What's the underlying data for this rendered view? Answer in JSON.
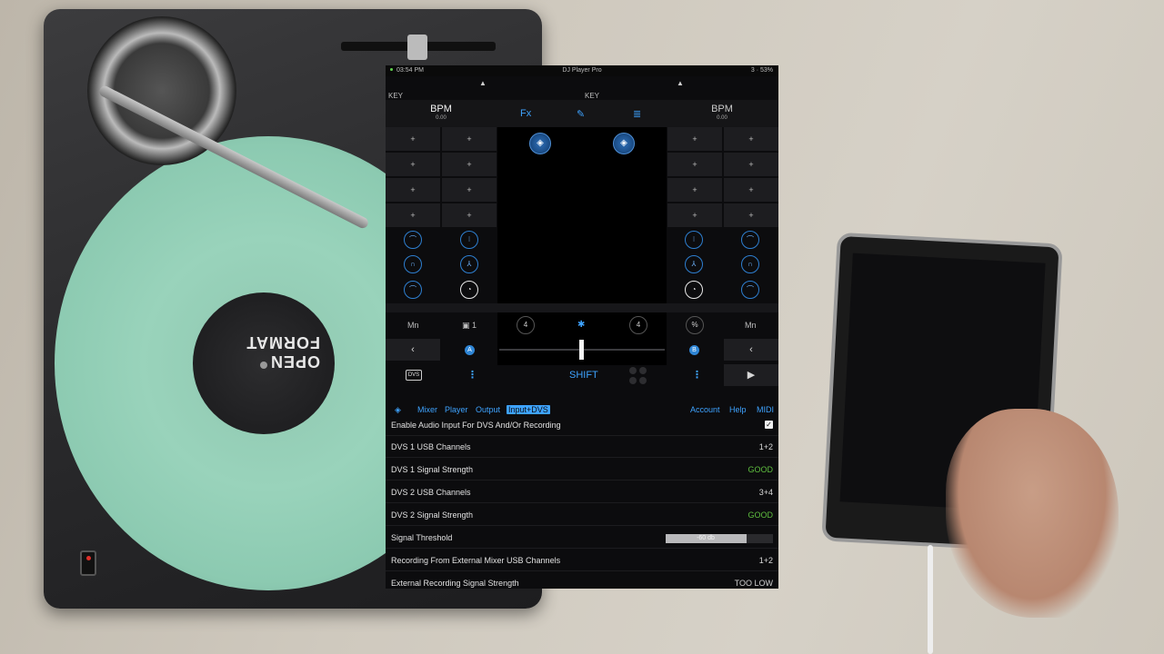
{
  "status_bar": {
    "time": "03:54 PM",
    "title": "DJ Player Pro",
    "battery": "3 · 53%"
  },
  "deck_left": {
    "key_label": "KEY",
    "bpm_label": "BPM",
    "bpm_value": "0.00",
    "eject": "▲"
  },
  "deck_right": {
    "key_label": "KEY",
    "bpm_label": "BPM",
    "bpm_value": "0.00",
    "eject": "▲"
  },
  "header_icons": {
    "fx": "Fx",
    "edit": "pencil-icon",
    "list": "list-icon"
  },
  "pad_symbol": "+",
  "controls": {
    "mn_left": "Mn",
    "mn_right": "Mn",
    "loop_count": "1",
    "left_ring": "4",
    "right_ring": "4",
    "percent": "%",
    "deck_a": "A",
    "deck_b": "B",
    "back_left": "‹",
    "back_right": "‹",
    "play": "▶",
    "dvs": "DVS",
    "shift": "SHIFT",
    "menu": "⋮"
  },
  "tabs": {
    "mixer": "Mixer",
    "player": "Player",
    "output": "Output",
    "input_dvs": "Input+DVS",
    "account": "Account",
    "help": "Help",
    "midi": "MIDI"
  },
  "settings": {
    "enable_audio": {
      "label": "Enable Audio Input For DVS And/Or Recording",
      "checked": true
    },
    "dvs1_usb": {
      "label": "DVS 1 USB Channels",
      "value": "1+2"
    },
    "dvs1_signal": {
      "label": "DVS 1 Signal Strength",
      "value": "GOOD"
    },
    "dvs2_usb": {
      "label": "DVS 2 USB Channels",
      "value": "3+4"
    },
    "dvs2_signal": {
      "label": "DVS 2 Signal Strength",
      "value": "GOOD"
    },
    "threshold": {
      "label": "Signal Threshold",
      "value": "-60 db",
      "fill_fraction": 0.75
    },
    "recording_usb": {
      "label": "Recording From External Mixer USB Channels",
      "value": "1+2"
    },
    "ext_signal": {
      "label": "External Recording Signal Strength",
      "value": "TOO LOW"
    }
  },
  "colors": {
    "accent": "#3ea3ff",
    "good": "#5fbf3f",
    "background": "#0c0c0e",
    "platter": "#99d3bb"
  },
  "background_scene": {
    "vinyl_label": "OPEN FORMAT"
  }
}
